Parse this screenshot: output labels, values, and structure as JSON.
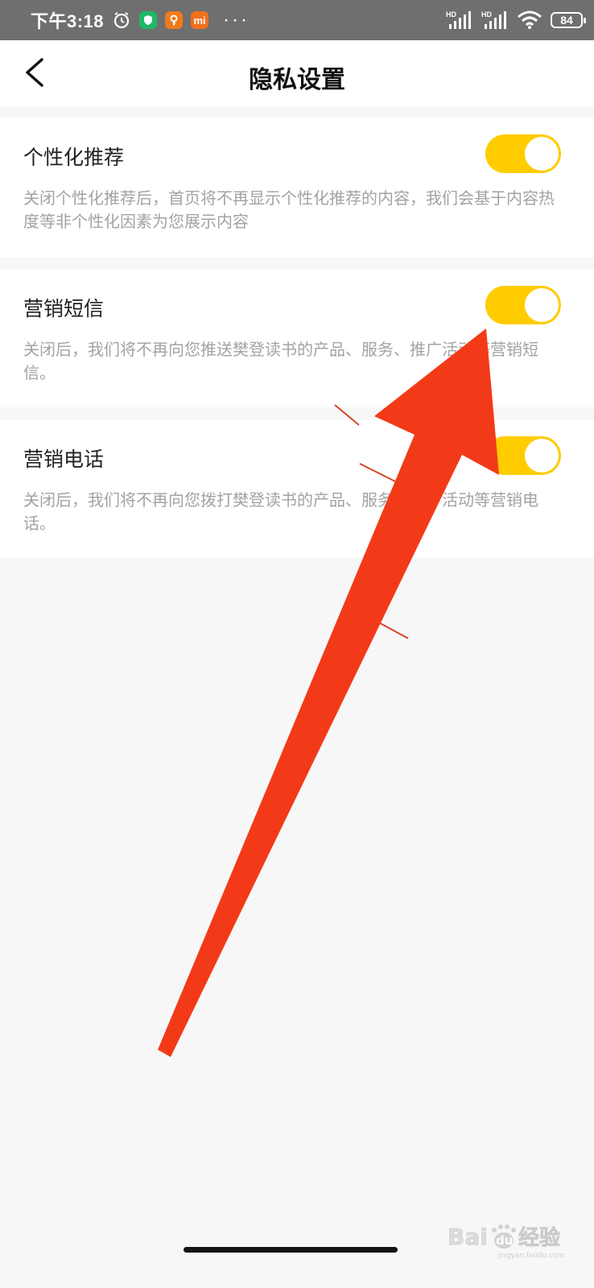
{
  "status_bar": {
    "time": "下午3:18",
    "battery": "84",
    "signal_1_label": "HD",
    "signal_2_label": "HD",
    "app_icons": [
      "shield-app-icon",
      "key-app-icon",
      "mi-app-icon"
    ],
    "mi_label": "mi",
    "more": "···"
  },
  "nav": {
    "title": "隐私设置"
  },
  "settings": [
    {
      "title": "个性化推荐",
      "description": "关闭个性化推荐后，首页将不再显示个性化推荐的内容，我们会基于内容热度等非个性化因素为您展示内容",
      "enabled": true
    },
    {
      "title": "营销短信",
      "description": "关闭后，我们将不再向您推送樊登读书的产品、服务、推广活动等营销短信。",
      "enabled": true
    },
    {
      "title": "营销电话",
      "description": "关闭后，我们将不再向您拨打樊登读书的产品、服务、推广活动等营销电话。",
      "enabled": true
    }
  ],
  "colors": {
    "toggle_on": "#ffcc00",
    "annotation_arrow": "#f33a18",
    "status_bar": "#6f6f6f"
  },
  "watermark": {
    "brand": "Bai",
    "paw": "du",
    "cn": "经验",
    "url": "jingyan.baidu.com"
  }
}
